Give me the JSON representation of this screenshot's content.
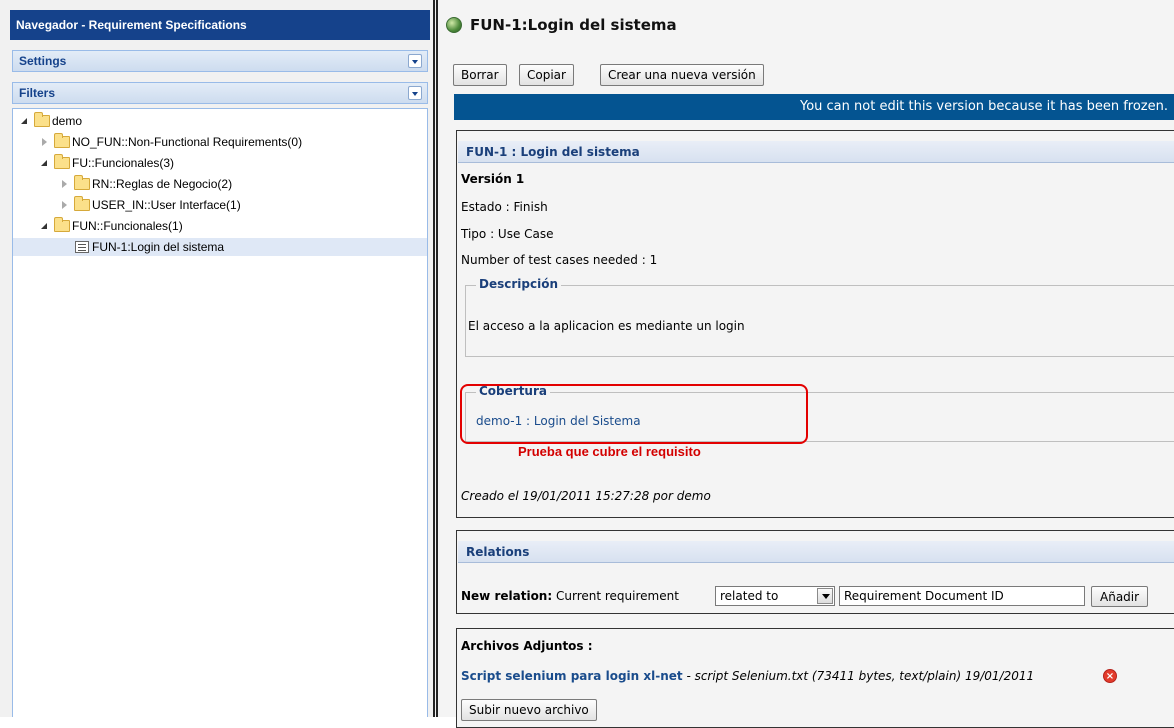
{
  "navigator": {
    "title": "Navegador - Requirement Specifications",
    "settings_label": "Settings",
    "filters_label": "Filters",
    "tree": {
      "root": "demo",
      "no_fun": "NO_FUN::Non-Functional Requirements(0)",
      "fu": "FU::Funcionales(3)",
      "rn": "RN::Reglas de Negocio(2)",
      "user_in": "USER_IN::User Interface(1)",
      "fun": "FUN::Funcionales(1)",
      "fun1": "FUN-1:Login del sistema"
    }
  },
  "main": {
    "title": "FUN-1:Login del sistema",
    "buttons": {
      "delete": "Borrar",
      "copy": "Copiar",
      "new_version": "Crear una nueva versión"
    },
    "frozen_message": "You can not edit this version because it has been frozen.",
    "requirement": {
      "header": "FUN-1 : Login del sistema",
      "version": "Versión 1",
      "status": "Estado : Finish",
      "type": "Tipo : Use Case",
      "test_cases": "Number of test cases needed : 1",
      "description_legend": "Descripción",
      "description_text": "El acceso a la aplicacion es mediante un login",
      "coverage_legend": "Cobertura",
      "coverage_link": "demo-1 : Login del Sistema",
      "annotation": "Prueba que cubre el requisito",
      "created": "Creado el 19/01/2011 15:27:28  por demo"
    },
    "relations": {
      "header": "Relations",
      "new_relation_label": "New relation:",
      "current_requirement_label": "Current requirement",
      "relation_type": "related to",
      "doc_id_value": "Requirement Document ID",
      "add_button": "Añadir"
    },
    "attachments": {
      "header": "Archivos Adjuntos :",
      "file_link": "Script selenium para login xl-net",
      "file_info": " - script Selenium.txt (73411 bytes, text/plain) 19/01/2011",
      "upload_button": "Subir nuevo archivo"
    }
  },
  "colors": {
    "accent": "#15428b",
    "frozen_bar": "#045491",
    "highlight": "#e30000"
  }
}
